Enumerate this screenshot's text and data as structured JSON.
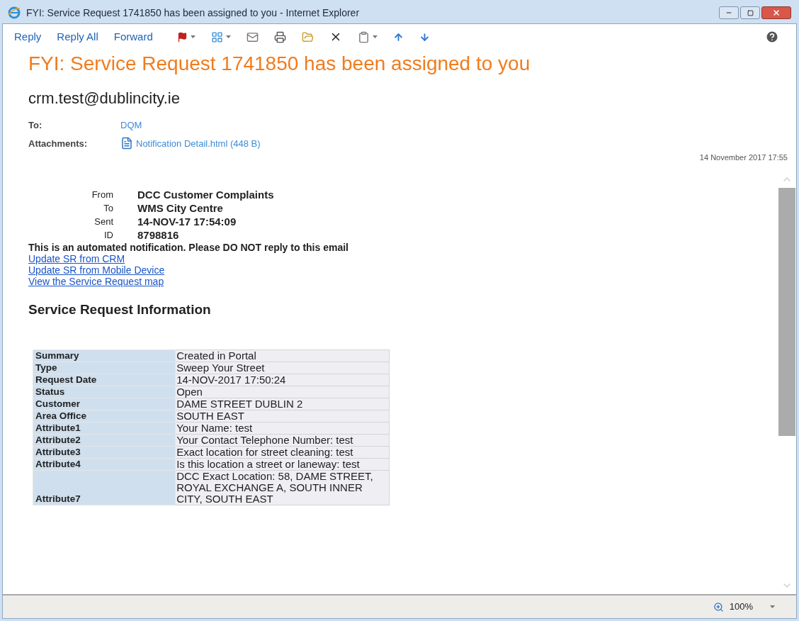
{
  "window": {
    "title": "FYI: Service Request 1741850 has been assigned to you - Internet Explorer"
  },
  "toolbar": {
    "actions": [
      "Reply",
      "Reply All",
      "Forward"
    ]
  },
  "message": {
    "subject": "FYI: Service Request 1741850 has been assigned to you",
    "sender": "crm.test@dublincity.ie",
    "to_label": "To:",
    "to": "DQM",
    "attachments_label": "Attachments:",
    "attachment": "Notification Detail.html (448 B)",
    "date": "14 November 2017 17:55"
  },
  "body": {
    "header_fields": [
      {
        "label": "From",
        "value": "DCC Customer Complaints"
      },
      {
        "label": "To",
        "value": "WMS City Centre"
      },
      {
        "label": "Sent",
        "value": "14-NOV-17 17:54:09"
      },
      {
        "label": "ID",
        "value": "8798816"
      }
    ],
    "notice": "This is an automated notification. Please DO NOT reply to this email",
    "links": [
      "Update SR from CRM",
      "Update SR from Mobile Device",
      "View the Service Request map"
    ],
    "section_title": "Service Request Information",
    "table": {
      "rows": [
        {
          "label": "Summary",
          "value": "Created in Portal"
        },
        {
          "label": "Type",
          "value": "Sweep Your Street"
        },
        {
          "label": "Request Date",
          "value": "14-NOV-2017 17:50:24"
        },
        {
          "label": "Status",
          "value": "Open"
        },
        {
          "label": "Customer",
          "value": "DAME STREET DUBLIN 2"
        },
        {
          "label": "Area Office",
          "value": "SOUTH EAST"
        },
        {
          "label": "Attribute1",
          "value": "Your Name: test"
        },
        {
          "label": "Attribute2",
          "value": "Your Contact Telephone Number: test"
        },
        {
          "label": "Attribute3",
          "value": "Exact location for street cleaning: test"
        },
        {
          "label": "Attribute4",
          "value": "Is this location a street or laneway: test"
        },
        {
          "label": "Attribute7",
          "value": "DCC Exact Location: 58, DAME STREET, ROYAL EXCHANGE A, SOUTH INNER CITY, SOUTH EAST"
        }
      ]
    }
  },
  "status_bar": {
    "zoom": "100%"
  }
}
